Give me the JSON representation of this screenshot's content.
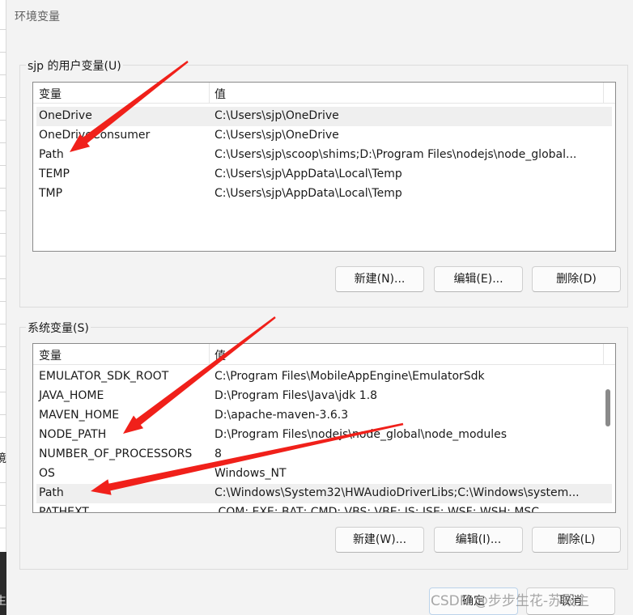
{
  "window": {
    "title": "环境变量"
  },
  "left_fragments": {
    "top": "境",
    "bottom": "生"
  },
  "user_vars": {
    "group_label": "sjp 的用户变量(U)",
    "col_name": "变量",
    "col_value": "值",
    "rows": [
      {
        "name": "OneDrive",
        "value": "C:\\Users\\sjp\\OneDrive",
        "selected": true
      },
      {
        "name": "OneDriveConsumer",
        "value": "C:\\Users\\sjp\\OneDrive",
        "selected": false
      },
      {
        "name": "Path",
        "value": "C:\\Users\\sjp\\scoop\\shims;D:\\Program Files\\nodejs\\node_global...",
        "selected": false
      },
      {
        "name": "TEMP",
        "value": "C:\\Users\\sjp\\AppData\\Local\\Temp",
        "selected": false
      },
      {
        "name": "TMP",
        "value": "C:\\Users\\sjp\\AppData\\Local\\Temp",
        "selected": false
      }
    ],
    "buttons": {
      "new": "新建(N)...",
      "edit": "编辑(E)...",
      "delete": "删除(D)"
    }
  },
  "system_vars": {
    "group_label": "系统变量(S)",
    "col_name": "变量",
    "col_value": "值",
    "rows": [
      {
        "name": "EMULATOR_SDK_ROOT",
        "value": "C:\\Program Files\\MobileAppEngine\\EmulatorSdk",
        "selected": false
      },
      {
        "name": "JAVA_HOME",
        "value": "D:\\Program Files\\Java\\jdk 1.8",
        "selected": false
      },
      {
        "name": "MAVEN_HOME",
        "value": "D:\\apache-maven-3.6.3",
        "selected": false
      },
      {
        "name": "NODE_PATH",
        "value": "D:\\Program Files\\nodejs\\node_global\\node_modules",
        "selected": false
      },
      {
        "name": "NUMBER_OF_PROCESSORS",
        "value": "8",
        "selected": false
      },
      {
        "name": "OS",
        "value": "Windows_NT",
        "selected": false
      },
      {
        "name": "Path",
        "value": "C:\\Windows\\System32\\HWAudioDriverLibs;C:\\Windows\\system...",
        "selected": true
      },
      {
        "name": "PATHEXT",
        "value": ".COM;.EXE;.BAT;.CMD;.VBS;.VBE;.JS;.JSE;.WSF;.WSH;.MSC",
        "selected": false
      }
    ],
    "buttons": {
      "new": "新建(W)...",
      "edit": "编辑(I)...",
      "delete": "删除(L)"
    }
  },
  "footer": {
    "ok": "确定",
    "cancel": "取消"
  },
  "watermark": "CSDN @步步生花-苏殿主",
  "colors": {
    "annotation_arrow": "#f0201a",
    "selected_row": "#efefef"
  }
}
